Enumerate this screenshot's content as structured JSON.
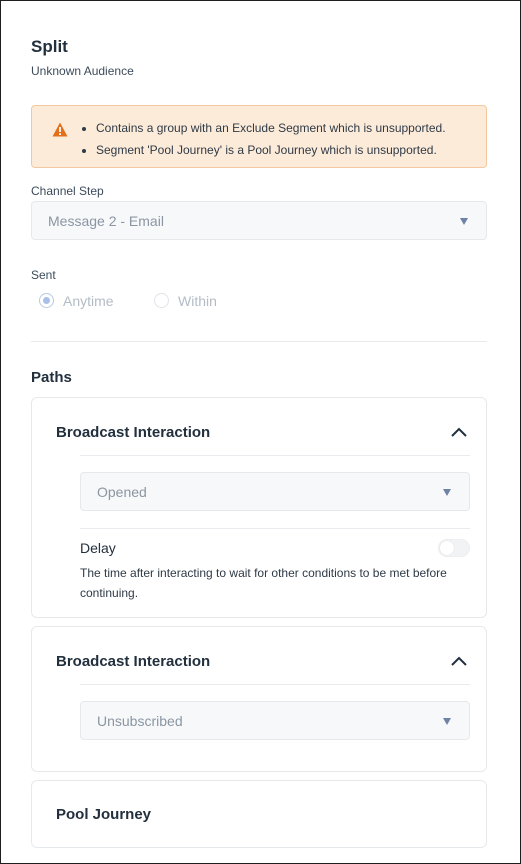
{
  "header": {
    "title": "Split",
    "subtitle": "Unknown Audience"
  },
  "warning": {
    "icon": "warning-triangle-icon",
    "color": "#e46f1a",
    "items": [
      "Contains a group with an Exclude Segment which is unsupported.",
      "Segment 'Pool Journey' is a Pool Journey which is unsupported."
    ]
  },
  "channel_step": {
    "label": "Channel Step",
    "value": "Message 2 - Email"
  },
  "sent": {
    "label": "Sent",
    "options": [
      {
        "label": "Anytime",
        "selected": true
      },
      {
        "label": "Within",
        "selected": false
      }
    ]
  },
  "paths": {
    "title": "Paths",
    "cards": [
      {
        "title": "Broadcast Interaction",
        "interaction": "Opened",
        "delay": {
          "label": "Delay",
          "enabled": false,
          "description": "The time after interacting to wait for other conditions to be met before continuing."
        }
      },
      {
        "title": "Broadcast Interaction",
        "interaction": "Unsubscribed"
      },
      {
        "title": "Pool Journey"
      }
    ]
  }
}
